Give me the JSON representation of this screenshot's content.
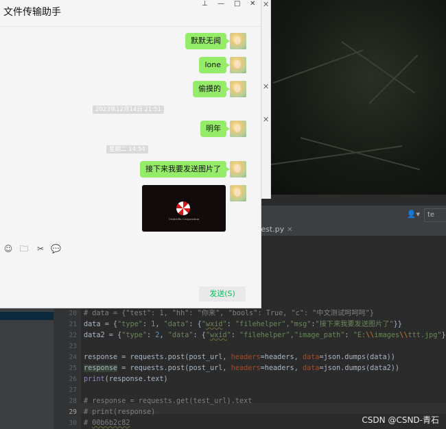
{
  "wechat": {
    "title": "文件传输助手",
    "controls": {
      "pin": "⊥",
      "minimize": "—",
      "maximize": "□",
      "close": "✕"
    },
    "messages": [
      {
        "type": "text",
        "text": "默默无闻"
      },
      {
        "type": "text",
        "text": "lone"
      },
      {
        "type": "text",
        "text": "偷摸的"
      },
      {
        "type": "timestamp",
        "text": "2023年12月14日 21:51"
      },
      {
        "type": "text",
        "text": "明年"
      },
      {
        "type": "timestamp",
        "text": "星期二 14:54"
      },
      {
        "type": "text",
        "text": "接下来我要发送图片了"
      },
      {
        "type": "image",
        "caption": "Umbrella Corporation"
      }
    ],
    "tools": [
      "emoji-icon",
      "folder-icon",
      "scissors-icon",
      "chat-icon"
    ],
    "send_label": "发送(S)",
    "accent_color": "#95ec69"
  },
  "ide": {
    "tab_label": "test.py",
    "line_numbers": [
      "20",
      "21",
      "22",
      "23",
      "24",
      "25",
      "26",
      "27",
      "28",
      "29",
      "30"
    ],
    "current_line": "29"
  },
  "watermark": "CSDN @CSND-青石"
}
